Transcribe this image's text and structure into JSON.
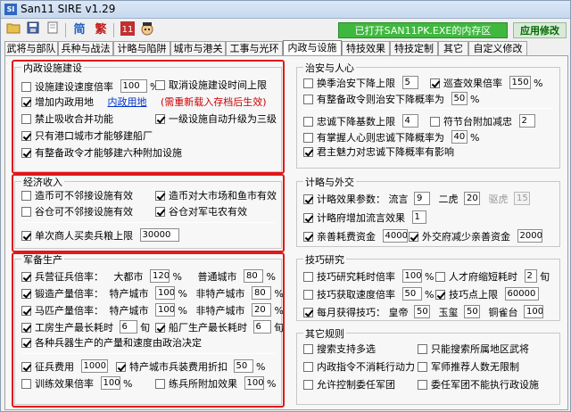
{
  "window": {
    "title": "San11 SIRE v1.29",
    "icon_text": "SI"
  },
  "toolbar": {
    "btn_simplified": "简",
    "btn_traditional": "繁",
    "status": "已打开SAN11PK.EXE的内存区",
    "apply_label": "应用修改"
  },
  "tabs": [
    "武将与部队",
    "兵种与战法",
    "计略与陷阱",
    "城市与港关",
    "工事与光环",
    "内政与设施",
    "特技效果",
    "特技定制",
    "其它",
    "自定义修改"
  ],
  "internal": {
    "title": "内政设施建设",
    "r1a": "设施建设速度倍率",
    "r1a_val": "100",
    "r1a_unit": "%",
    "r1b": "取消设施建设时间上限",
    "r2a": "增加内政用地",
    "r2_link": "内政用地",
    "r2_note": "(需重新载入存档后生效)",
    "r3a": "禁止吸收合并功能",
    "r3b": "一级设施自动升级为三级",
    "r4": "只有港口城市才能够建船厂",
    "r5": "有整备政令才能够建六种附加设施"
  },
  "economy": {
    "title": "经济收入",
    "r1a": "造币可不邻接设施有效",
    "r1b": "造币对大市场和鱼市有效",
    "r2a": "谷仓可不邻接设施有效",
    "r2b": "谷仓对军屯农有效",
    "r3": "单次商人买卖兵粮上限",
    "r3_val": "30000"
  },
  "military": {
    "title": "军备生产",
    "r1": "兵营征兵倍率：",
    "r1_l1": "大都市",
    "r1_v1": "120",
    "r1_l2": "普通城市",
    "r1_v2": "80",
    "r2": "锻造产量倍率：",
    "r2_l1": "特产城市",
    "r2_v1": "100",
    "r2_l2": "非特产城市",
    "r2_v2": "80",
    "r3": "马匹产量倍率：",
    "r3_l1": "特产城市",
    "r3_v1": "100",
    "r3_l2": "非特产城市",
    "r3_v2": "20",
    "unit": "%",
    "r4a": "工房生产最长耗时",
    "r4a_val": "6",
    "r4_unit": "旬",
    "r4b": "船厂生产最长耗时",
    "r4b_val": "6",
    "r5": "各种兵器生产的产量和速度由政治决定",
    "r6a": "征兵费用",
    "r6a_val": "1000",
    "r6b": "特产城市兵装费用折扣",
    "r6b_val": "50",
    "r7a": "训练效果倍率",
    "r7a_val": "100",
    "r7b": "练兵所附加效果",
    "r7b_val": "100"
  },
  "peace": {
    "title": "治安与人心",
    "r1a": "换季治安下降上限",
    "r1a_val": "5",
    "r1b": "巡查效果倍率",
    "r1b_val": "150",
    "r1b_unit": "%",
    "r2": "有整备政令则治安下降概率为",
    "r2_val": "50",
    "unit": "%",
    "r3a": "忠诚下降基数上限",
    "r3a_val": "4",
    "r3b": "符节台附加减忠",
    "r3b_val": "2",
    "r4": "有掌握人心则忠诚下降概率为",
    "r4_val": "40",
    "r5": "君主魅力对忠诚下降概率有影响"
  },
  "diplomacy": {
    "title": "计略与外交",
    "r1": "计略效果参数：",
    "r1_l1": "流言",
    "r1_v1": "9",
    "r1_l2": "二虎",
    "r1_v2": "20",
    "r1_l3": "驱虎",
    "r1_v3": "15",
    "r2": "计略府增加流言效果",
    "r2_val": "1",
    "r3a": "亲善耗费资金",
    "r3a_val": "4000",
    "r3b": "外交府减少亲善资金",
    "r3b_val": "2000"
  },
  "tech": {
    "title": "技巧研究",
    "r1a": "技巧研究耗时倍率",
    "r1a_val": "100",
    "unit": "%",
    "r1b": "人才府缩短耗时",
    "r1b_val": "2",
    "r1b_unit": "旬",
    "r2a": "技巧获取速度倍率",
    "r2a_val": "50",
    "r2b": "技巧点上限",
    "r2b_val": "60000",
    "r3": "每月获得技巧：",
    "r3_l1": "皇帝",
    "r3_v1": "50",
    "r3_l2": "玉玺",
    "r3_v2": "50",
    "r3_l3": "铜雀台",
    "r3_v3": "100"
  },
  "other": {
    "title": "其它规则",
    "r1a": "搜索支持多选",
    "r1b": "只能搜索所属地区武将",
    "r2a": "内政指令不消耗行动力",
    "r2b": "军师推荐人数无限制",
    "r3a": "允许控制委任军团",
    "r3b": "委任军团不能执行政设施"
  }
}
